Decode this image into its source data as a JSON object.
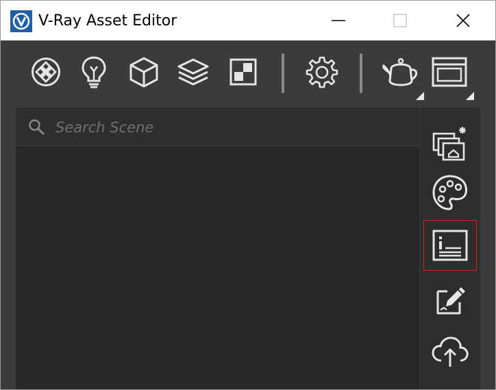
{
  "window": {
    "title": "V-Ray Asset Editor"
  },
  "titlebar_controls": {
    "minimize_icon": "minimize-icon",
    "maximize_icon": "maximize-icon",
    "close_icon": "close-icon"
  },
  "toolbar": {
    "items": [
      "materials-icon",
      "lights-icon",
      "geometry-icon",
      "render-elements-icon",
      "textures-icon",
      "settings-icon",
      "render-teapot-icon",
      "frame-buffer-icon"
    ]
  },
  "search": {
    "placeholder": "Search Scene",
    "value": ""
  },
  "sidebar": {
    "items": [
      "create-asset-icon",
      "palette-icon",
      "asset-info-icon",
      "edit-asset-icon",
      "cloud-upload-icon"
    ],
    "selected": "asset-info-icon"
  },
  "colors": {
    "title_bg": "#ffffff",
    "toolbar_bg": "#3b3b3b",
    "panel_bg": "#282828",
    "sidebar_bg": "#2d2d2d",
    "selection": "#e02020",
    "icon": "#e6e6e6"
  }
}
